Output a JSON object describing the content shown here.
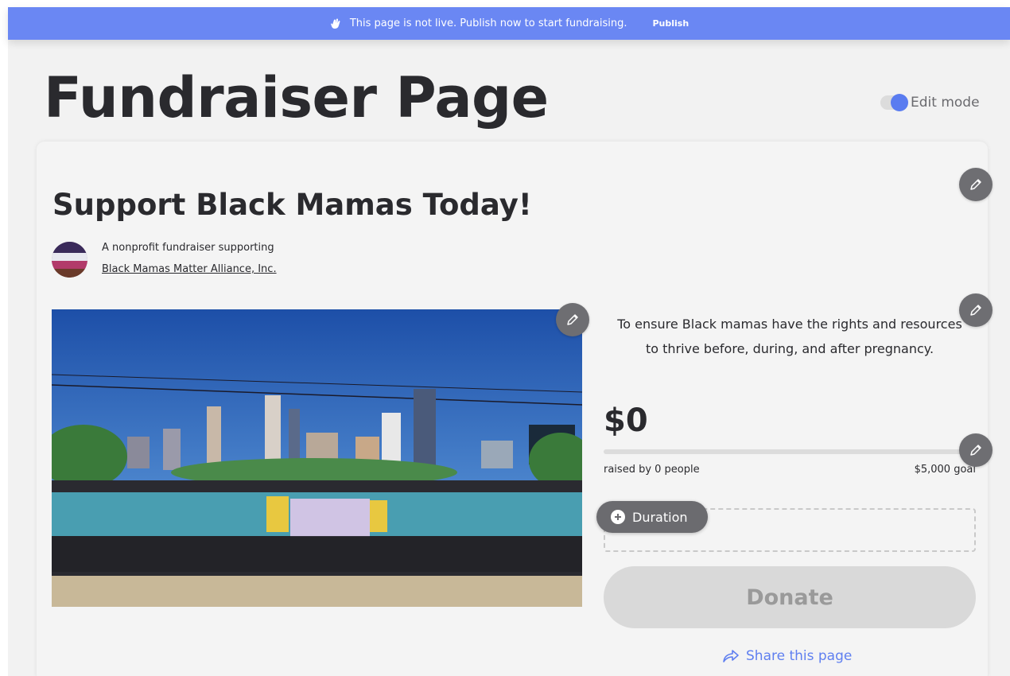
{
  "banner": {
    "message": "This page is not live. Publish now to start fundraising.",
    "publish_label": "Publish",
    "icon": "waving-hand-icon",
    "background": "#6a87f3"
  },
  "header": {
    "title": "Fundraiser Page",
    "edit_mode_label": "Edit mode",
    "edit_mode_on": true
  },
  "fundraiser": {
    "title": "Support Black Mamas Today!",
    "org_intro": "A nonprofit fundraiser supporting",
    "org_name": "Black Mamas Matter Alliance, Inc.",
    "mission_line1": "To ensure Black mamas have the rights and resources",
    "mission_line2": "to thrive before, during, and after pregnancy.",
    "amount_raised": "$0",
    "progress_fraction": 0,
    "raised_by": "raised by 0 people",
    "goal": "$5,000 goal",
    "duration_label": "Duration",
    "donate_label": "Donate",
    "share_label": "Share this page"
  },
  "colors": {
    "accent": "#5f7ff0",
    "edit_button": "#6e6e72",
    "donate_disabled": "#d9d9d9"
  }
}
